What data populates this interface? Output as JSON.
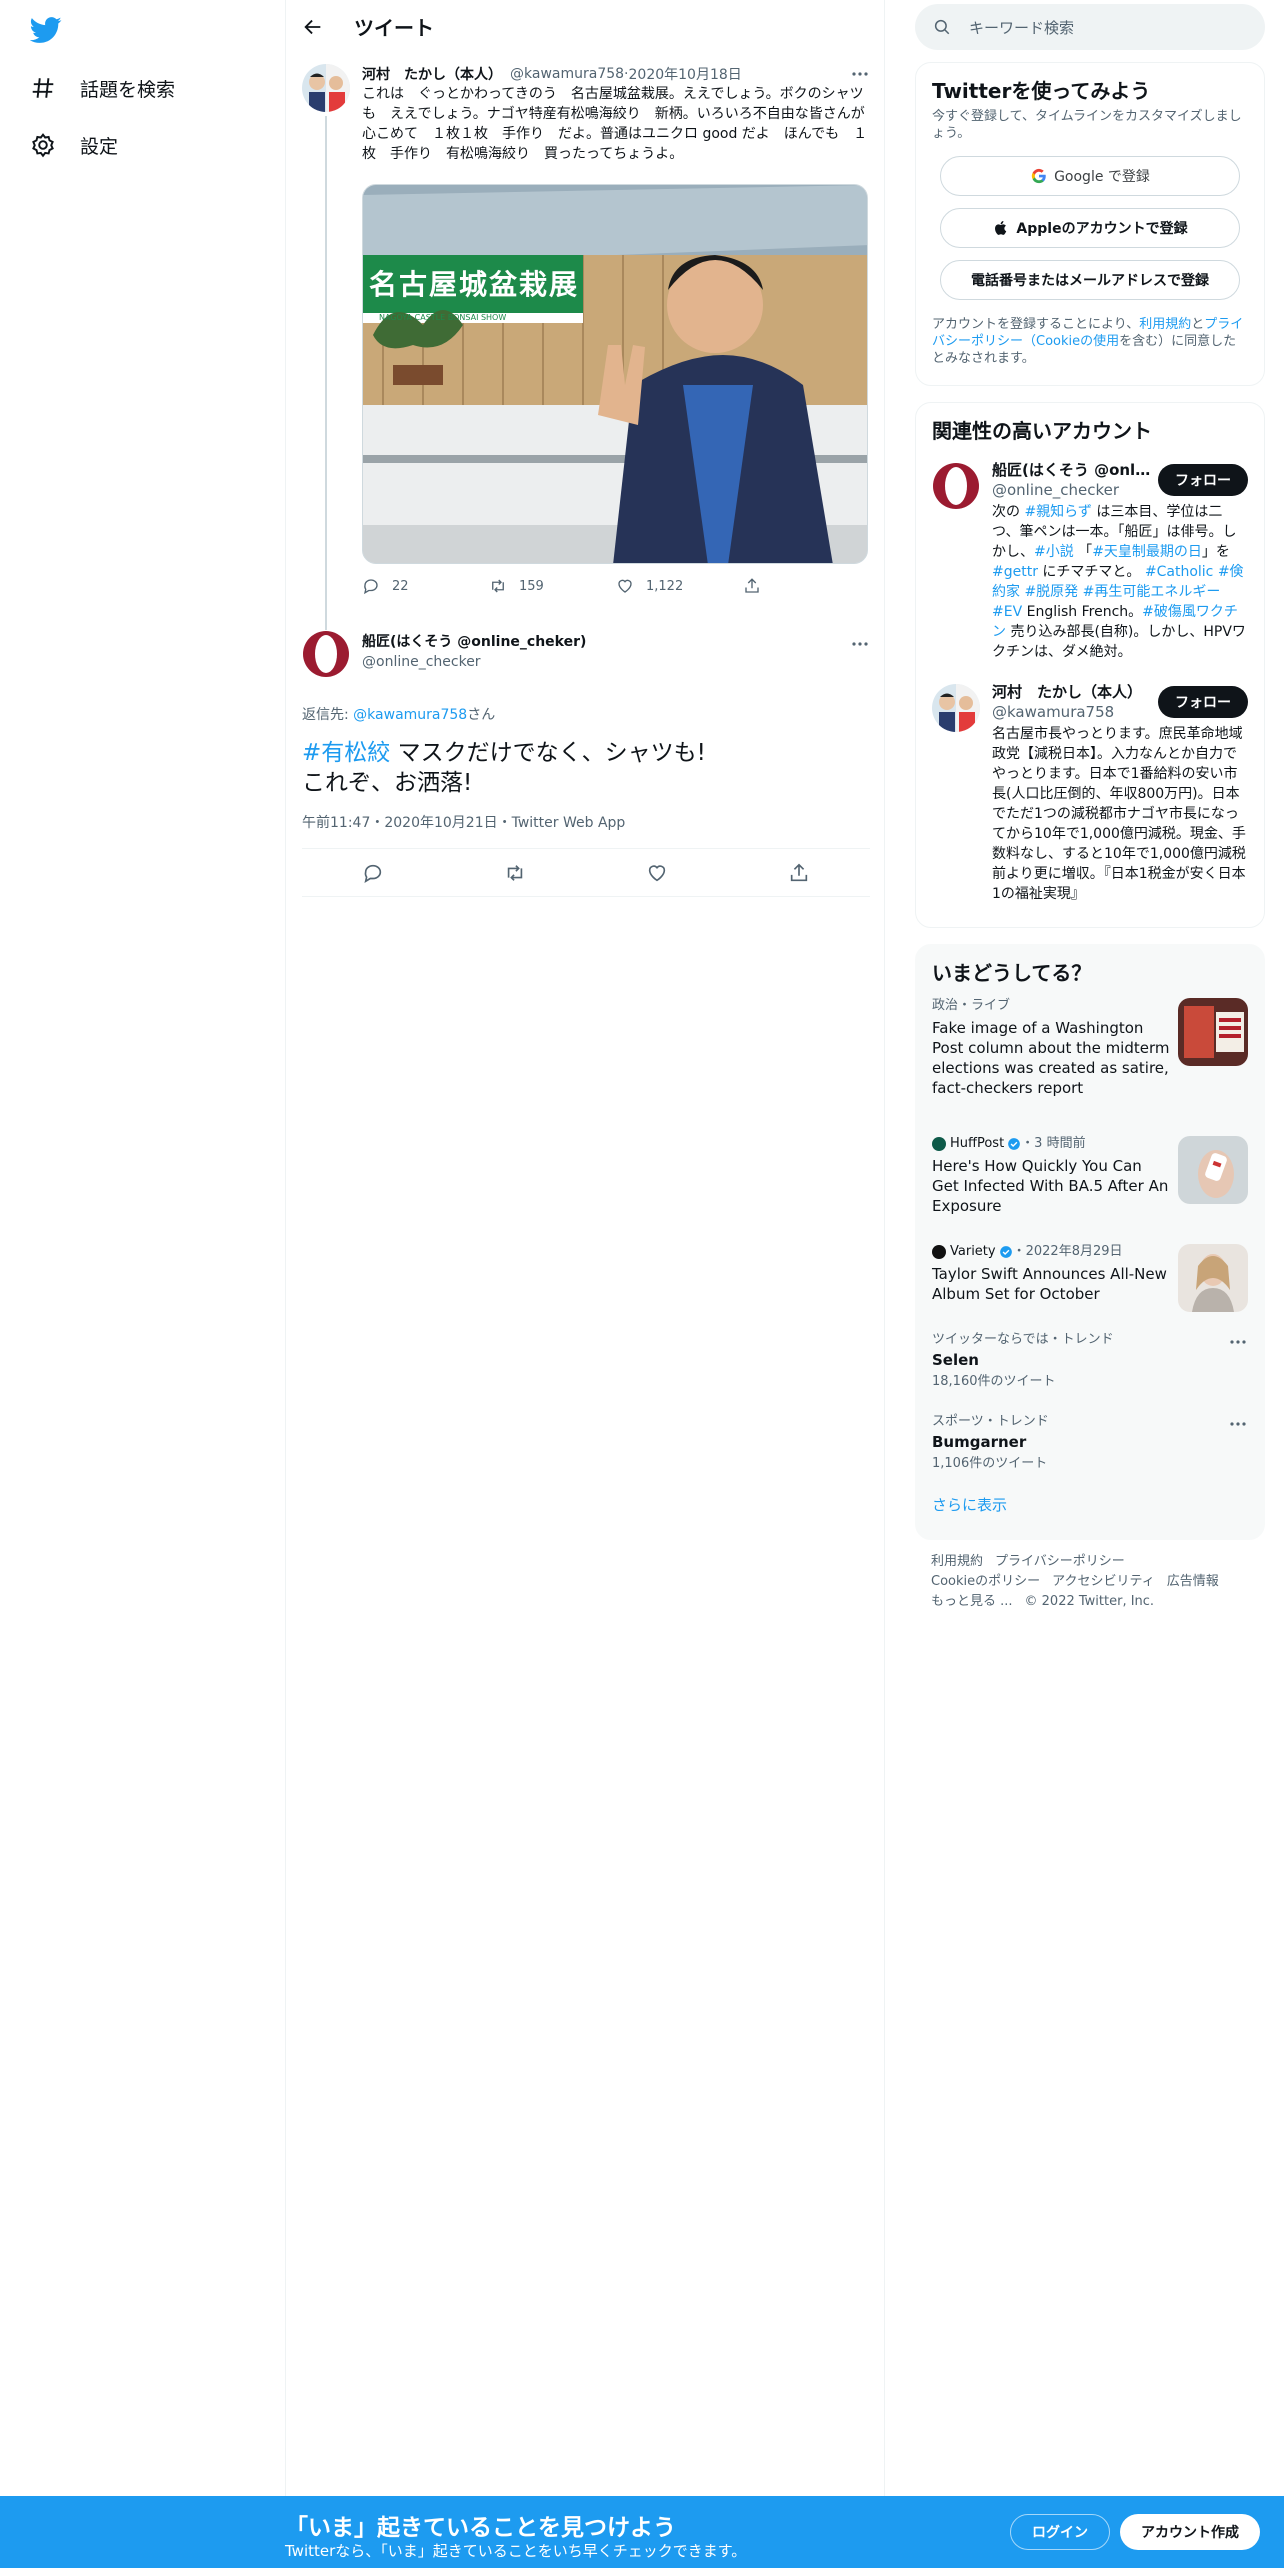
{
  "nav": {
    "explore_label": "話題を検索",
    "settings_label": "設定"
  },
  "header": {
    "title": "ツイート"
  },
  "parent_tweet": {
    "name": "河村　たかし（本人）",
    "handle": "@kawamura758",
    "date": "2020年10月18日",
    "text": "これは　ぐっとかわってきのう　名古屋城盆栽展。ええでしょう。ボクのシャツも　ええでしょう。ナゴヤ特産有松鳴海絞り　新柄。いろいろ不自由な皆さんが　心こめて　１枚１枚　手作り　だよ。普通はユニクロ good だよ　ほんでも　１枚　手作り　有松鳴海絞り　買ったってちょうよ。",
    "image_banner": "名古屋城盆栽展",
    "image_banner_en": "NAGOYA CASTLE BONSAI SHOW",
    "replies": "22",
    "retweets": "159",
    "likes": "1,122"
  },
  "main_tweet": {
    "name": "船匠(はくそう @online_cheker)",
    "handle": "@online_checker",
    "reply_prefix": "返信先: ",
    "reply_handle": "@kawamura758",
    "reply_suffix": "さん",
    "hashtag": "#有松絞",
    "text_line1": " マスクだけでなく、シャツも!",
    "text_line2": "これぞ、お洒落!",
    "meta": "午前11:47・2020年10月21日・Twitter Web App"
  },
  "search": {
    "placeholder": "キーワード検索"
  },
  "signup_card": {
    "title": "Twitterを使ってみよう",
    "subtitle": "今すぐ登録して、タイムラインをカスタマイズしましょう。",
    "google": "Google で登録",
    "apple": "Appleのアカウントで登録",
    "phone": "電話番号またはメールアドレスで登録",
    "legal_1": "アカウントを登録することにより、",
    "legal_terms": "利用規約",
    "legal_2": "と",
    "legal_privacy": "プライバシーポリシー（Cookieの使用",
    "legal_3": "を含む）に同意したとみなされます。"
  },
  "related": {
    "title": "関連性の高いアカウント",
    "follow_label": "フォロー",
    "acc1": {
      "name": "船匠(はくそう @onli...",
      "handle": "@online_checker",
      "bio_1": "次の ",
      "bio_tag1": "#親知らず",
      "bio_2": " は三本目、学位は二つ、筆ペンは一本。「船匠」は俳号。しかし、",
      "bio_tag2": "#小説",
      "bio_3": " 「",
      "bio_tag3": "#天皇制最期の日",
      "bio_4": "」を ",
      "bio_tag4": "#gettr",
      "bio_5": " にチマチマと。 ",
      "bio_tag5": "#Catholic #倹約家 #脱原発 #再生可能エネルギー #EV",
      "bio_6": " English French。",
      "bio_tag6": "#破傷風ワクチン",
      "bio_7": " 売り込み部長(自称)。しかし、HPVワクチンは、ダメ絶対。"
    },
    "acc2": {
      "name": "河村　たかし（本人）",
      "handle": "@kawamura758",
      "bio": "名古屋市長やっとります。庶民革命地域政党【減税日本】。入力なんとか自力でやっとります。日本で1番給料の安い市長(人口比圧倒的、年収800万円)。日本でただ1つの減税都市ナゴヤ市長になってから10年で1,000億円減税。現金、手数料なし、すると10年で1,000億円減税前より更に増収。『日本1税金が安く日本1の福祉実現』"
    }
  },
  "trends": {
    "title": "いまどうしてる？",
    "items": [
      {
        "context": "政治・ライブ",
        "headline": "Fake image of a Washington Post column about the midterm elections was created as satire, fact-checkers report"
      },
      {
        "source": "HuffPost",
        "context": "・3 時間前",
        "headline": "Here's How Quickly You Can Get Infected With BA.5 After An Exposure"
      },
      {
        "source": "Variety",
        "context": "・2022年8月29日",
        "headline": "Taylor Swift Announces All-New Album Set for October"
      },
      {
        "context": "ツイッターならでは・トレンド",
        "name": "Selen",
        "count": "18,160件のツイート"
      },
      {
        "context": "スポーツ・トレンド",
        "name": "Bumgarner",
        "count": "1,106件のツイート"
      }
    ],
    "show_more": "さらに表示"
  },
  "footer": {
    "terms": "利用規約",
    "privacy": "プライバシーポリシー",
    "cookie": "Cookieのポリシー",
    "accessibility": "アクセシビリティ",
    "ads": "広告情報",
    "more": "もっと見る ...",
    "copyright": "© 2022 Twitter, Inc."
  },
  "banner": {
    "title": "「いま」起きていることを見つけよう",
    "subtitle": "Twitterなら、「いま」起きていることをいち早くチェックできます。",
    "login": "ログイン",
    "signup": "アカウント作成"
  },
  "colors": {
    "brand": "#1d9bf0",
    "text": "#0f1419",
    "muted": "#536471"
  }
}
